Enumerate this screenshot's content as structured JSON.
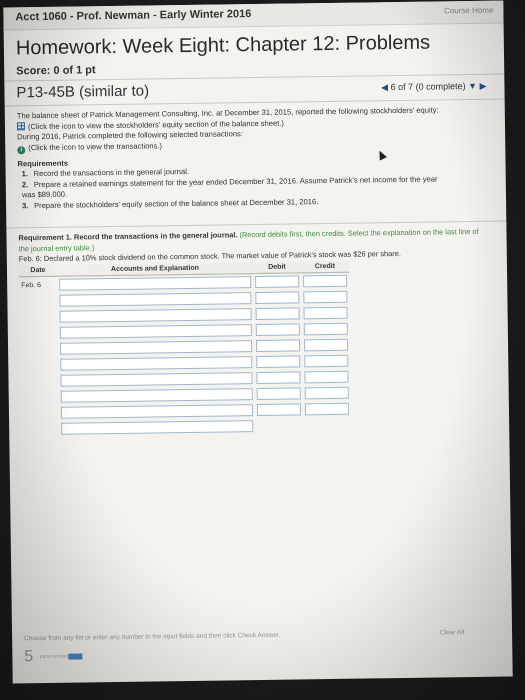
{
  "topbar": {
    "course": "Acct 1060 - Prof. Newman - Early Winter 2016",
    "home_link": "Course Home"
  },
  "header": {
    "title": "Homework: Week Eight: Chapter 12: Problems",
    "score": "Score: 0 of 1 pt"
  },
  "problem": {
    "id": "P13-45B (similar to)",
    "nav_text": "6 of 7 (0 complete)",
    "intro_1": "The balance sheet of Patrick Management Consulting, Inc. at December 31, 2015, reported the following stockholders' equity:",
    "icon_link_1": "(Click the icon to view the stockholders' equity section of the balance sheet.)",
    "intro_2": "During 2016, Patrick completed the following selected transactions:",
    "icon_link_2": "(Click the icon to view the transactions.)",
    "requirements_heading": "Requirements",
    "requirements": [
      {
        "num": "1.",
        "text": "Record the transactions in the general journal."
      },
      {
        "num": "2.",
        "text": "Prepare a retained earnings statement for the year ended December 31, 2016. Assume Patrick's net income for the year was $89,000."
      },
      {
        "num": "3.",
        "text": "Prepare the stockholders' equity section of the balance sheet at December 31, 2016."
      }
    ]
  },
  "requirement1": {
    "intro": "Requirement 1. Record the transactions in the general journal.",
    "hint": "(Record debits first, then credits. Select the explanation on the last line of the journal entry table.)",
    "question": "Feb. 6: Declared a 10% stock dividend on the common stock. The market value of Patrick's stock was $26 per share."
  },
  "journal": {
    "headers": {
      "date": "Date",
      "accounts": "Accounts and Explanation",
      "debit": "Debit",
      "credit": "Credit"
    },
    "date_value": "Feb. 6"
  },
  "footer": {
    "hint": "Choose from any list or enter any number in the input fields and then click Check Answer.",
    "clear_all": "Clear All",
    "parts_count": "5",
    "parts_label": "parts remaining"
  },
  "colors": {
    "accent_blue": "#1f4f8f",
    "hint_green": "#3c8c3c",
    "progress_blue": "#4a86c5"
  }
}
